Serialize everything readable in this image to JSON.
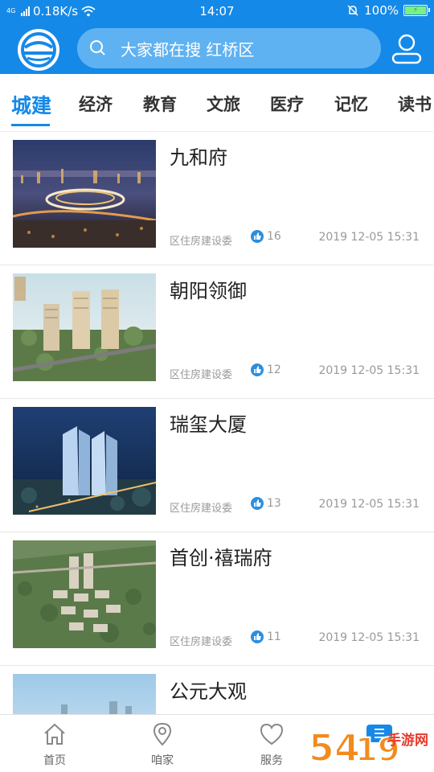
{
  "status_bar": {
    "network_type": "4G",
    "speed": "0.18K/s",
    "time": "14:07",
    "battery": "100%",
    "battery_level": 1.0
  },
  "header": {
    "search_placeholder": "大家都在搜 红桥区",
    "logo_icon": "city-logo-icon",
    "search_icon": "search-icon",
    "user_icon": "user-icon"
  },
  "tabs": [
    {
      "label": "城建",
      "active": true
    },
    {
      "label": "经济",
      "active": false
    },
    {
      "label": "教育",
      "active": false
    },
    {
      "label": "文旅",
      "active": false
    },
    {
      "label": "医疗",
      "active": false
    },
    {
      "label": "记忆",
      "active": false
    },
    {
      "label": "读书",
      "active": false
    }
  ],
  "articles": [
    {
      "title": "九和府",
      "source": "区住房建设委",
      "likes": "16",
      "date": "2019 12-05 15:31"
    },
    {
      "title": "朝阳领御",
      "source": "区住房建设委",
      "likes": "12",
      "date": "2019 12-05 15:31"
    },
    {
      "title": "瑞玺大厦",
      "source": "区住房建设委",
      "likes": "13",
      "date": "2019 12-05 15:31"
    },
    {
      "title": "首创·禧瑞府",
      "source": "区住房建设委",
      "likes": "11",
      "date": "2019 12-05 15:31"
    },
    {
      "title": "公元大观",
      "source": "",
      "likes": "",
      "date": ""
    }
  ],
  "bottom_nav": [
    {
      "label": "首页",
      "icon": "home-icon"
    },
    {
      "label": "咱家",
      "icon": "location-pin-icon"
    },
    {
      "label": "服务",
      "icon": "heart-icon"
    },
    {
      "label": "",
      "icon": "menu-list-icon"
    }
  ],
  "watermark": "54手游网",
  "colors": {
    "primary": "#1589e8",
    "search_bg": "#5fb2f2",
    "text_dark": "#222222",
    "text_muted": "#999999"
  }
}
